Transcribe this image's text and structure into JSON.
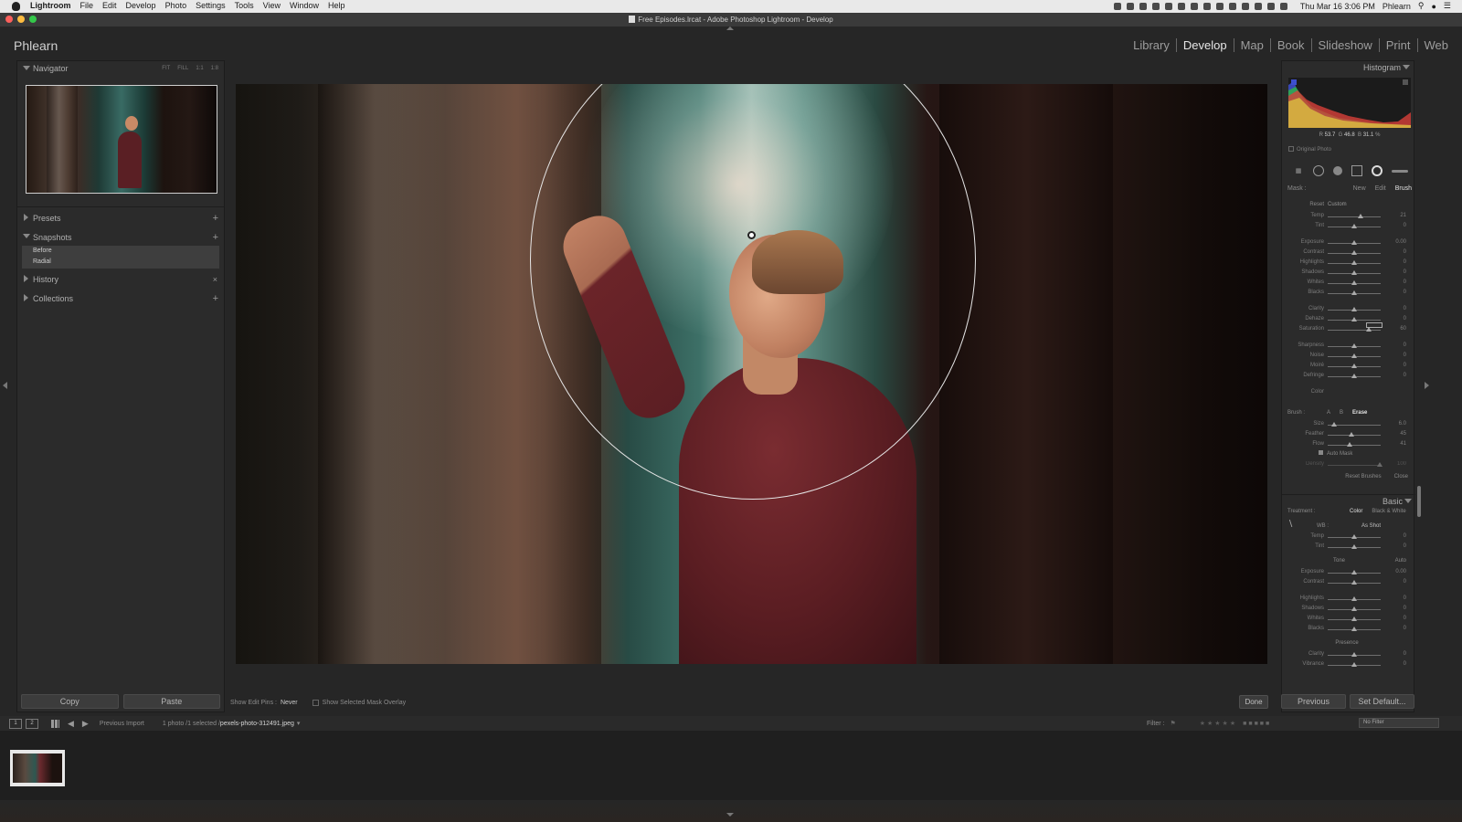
{
  "macos_menubar": {
    "app": "Lightroom",
    "menus": [
      "File",
      "Edit",
      "Develop",
      "Photo",
      "Settings",
      "Tools",
      "View",
      "Window",
      "Help"
    ],
    "datetime": "Thu Mar 16 3:06 PM",
    "user": "Phlearn"
  },
  "window": {
    "title": "Free Episodes.lrcat - Adobe Photoshop Lightroom - Develop",
    "traffic_light_colors": [
      "#fc605c",
      "#fdbc40",
      "#34c84a"
    ]
  },
  "identity_plate": "Phlearn",
  "modules": [
    {
      "label": "Library"
    },
    {
      "label": "Develop"
    },
    {
      "label": "Map"
    },
    {
      "label": "Book"
    },
    {
      "label": "Slideshow"
    },
    {
      "label": "Print"
    },
    {
      "label": "Web"
    }
  ],
  "active_module": "Develop",
  "left_panel": {
    "navigator": {
      "title": "Navigator",
      "zoom_options": [
        "FIT",
        "FILL",
        "1:1",
        "1:8"
      ]
    },
    "presets": "Presets",
    "snapshots": {
      "title": "Snapshots",
      "items": [
        "Before",
        "Radial"
      ]
    },
    "history": "History",
    "collections": "Collections",
    "copy_button": "Copy",
    "paste_button": "Paste"
  },
  "toolbar": {
    "edit_pins_label": "Show Edit Pins :",
    "edit_pins_value": "Never",
    "mask_overlay_label": "Show Selected Mask Overlay",
    "done_button": "Done"
  },
  "right_panel": {
    "histogram": {
      "title": "Histogram",
      "r_label": "R",
      "r_value": "53.7",
      "g_label": "G",
      "g_value": "46.8",
      "b_label": "B",
      "b_value": "31.1",
      "unit": "%",
      "original_photo": "Original Photo"
    },
    "mask": {
      "label": "Mask :",
      "new": "New",
      "edit": "Edit",
      "brush": "Brush"
    },
    "effect": {
      "label": "Reset",
      "value": "Custom"
    },
    "adjustments_group1": [
      {
        "label": "Temp",
        "value": "21",
        "pos": 0.62
      },
      {
        "label": "Tint",
        "value": "0",
        "pos": 0.5
      }
    ],
    "adjustments_group2": [
      {
        "label": "Exposure",
        "value": "0.00",
        "pos": 0.5
      },
      {
        "label": "Contrast",
        "value": "0",
        "pos": 0.5
      },
      {
        "label": "Highlights",
        "value": "0",
        "pos": 0.5
      },
      {
        "label": "Shadows",
        "value": "0",
        "pos": 0.5
      },
      {
        "label": "Whites",
        "value": "0",
        "pos": 0.5
      },
      {
        "label": "Blacks",
        "value": "0",
        "pos": 0.5
      }
    ],
    "adjustments_group3": [
      {
        "label": "Clarity",
        "value": "0",
        "pos": 0.5
      },
      {
        "label": "Dehaze",
        "value": "0",
        "pos": 0.5
      },
      {
        "label": "Saturation",
        "value": "60",
        "pos": 0.78
      }
    ],
    "adjustments_group4": [
      {
        "label": "Sharpness",
        "value": "0",
        "pos": 0.5
      },
      {
        "label": "Noise",
        "value": "0",
        "pos": 0.5
      },
      {
        "label": "Moiré",
        "value": "0",
        "pos": 0.5
      },
      {
        "label": "Defringe",
        "value": "0",
        "pos": 0.5
      }
    ],
    "color_label": "Color",
    "brush": {
      "label": "Brush :",
      "a": "A",
      "b": "B",
      "erase": "Erase",
      "size": {
        "label": "Size",
        "value": "6.0",
        "pos": 0.12
      },
      "feather": {
        "label": "Feather",
        "value": "45",
        "pos": 0.45
      },
      "flow": {
        "label": "Flow",
        "value": "41",
        "pos": 0.41
      },
      "auto_mask": "Auto Mask",
      "density": {
        "label": "Density",
        "value": "100",
        "pos": 0.98
      },
      "reset_brushes": "Reset Brushes",
      "close": "Close"
    },
    "basic": {
      "title": "Basic",
      "treatment_label": "Treatment :",
      "color": "Color",
      "bw": "Black & White",
      "wb_label": "WB :",
      "wb_value": "As Shot",
      "temp": {
        "label": "Temp",
        "value": "0",
        "pos": 0.5
      },
      "tint": {
        "label": "Tint",
        "value": "0",
        "pos": 0.5
      },
      "tone": "Tone",
      "auto": "Auto",
      "exposure": {
        "label": "Exposure",
        "value": "0.00",
        "pos": 0.5
      },
      "contrast": {
        "label": "Contrast",
        "value": "0",
        "pos": 0.5
      },
      "highlights": {
        "label": "Highlights",
        "value": "0",
        "pos": 0.5
      },
      "shadows": {
        "label": "Shadows",
        "value": "0",
        "pos": 0.5
      },
      "whites": {
        "label": "Whites",
        "value": "0",
        "pos": 0.5
      },
      "blacks": {
        "label": "Blacks",
        "value": "0",
        "pos": 0.5
      },
      "presence": "Presence",
      "clarity": {
        "label": "Clarity",
        "value": "0",
        "pos": 0.5
      },
      "vibrance": {
        "label": "Vibrance",
        "value": "0",
        "pos": 0.5
      }
    },
    "previous_button": "Previous",
    "set_default_button": "Set Default..."
  },
  "filmstrip": {
    "screen1": "1",
    "screen2": "2",
    "source": "Previous Import",
    "count": "1 photo /1 selected /",
    "filename": "pexels-photo-312491.jpeg",
    "filter_label": "Filter :",
    "filter_value": "No Filter"
  },
  "colors": {
    "mask_circle": "#e5e5e5",
    "panel_bg": "#2b2b2b",
    "active_module": "#e6e6e6"
  }
}
